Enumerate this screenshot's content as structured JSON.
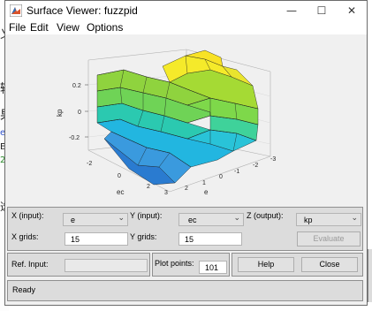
{
  "background": {
    "fragments": [
      "义",
      "输",
      "果",
      "e",
      "E",
      "2",
      "选"
    ]
  },
  "window": {
    "title": "Surface Viewer: fuzzpid",
    "controls": {
      "minimize": "—",
      "maximize": "☐",
      "close": "✕"
    }
  },
  "menu": [
    "File",
    "Edit",
    "View",
    "Options"
  ],
  "plot": {
    "z_label": "kp",
    "x_label": "e",
    "y_label": "ec",
    "z_ticks": [
      "0.2",
      "0",
      "-0.2"
    ],
    "e_ticks": [
      "3",
      "2",
      "1",
      "0",
      "-1",
      "-2",
      "-3"
    ],
    "ec_ticks": [
      "-2",
      "0",
      "2"
    ],
    "ec_corner_tick": "3",
    "colors": {
      "high": "#f5ea2a",
      "mid": "#8fd33e",
      "low": "#22b6e0",
      "base": "#2a7bd0"
    }
  },
  "controls": {
    "x_input_label": "X (input):",
    "x_input_value": "e",
    "y_input_label": "Y (input):",
    "y_input_value": "ec",
    "z_output_label": "Z (output):",
    "z_output_value": "kp",
    "x_grids_label": "X grids:",
    "x_grids_value": "15",
    "y_grids_label": "Y grids:",
    "y_grids_value": "15",
    "evaluate_label": "Evaluate",
    "ref_input_label": "Ref. Input:",
    "ref_input_value": "",
    "plot_points_label": "Plot points:",
    "plot_points_value": "101",
    "help_label": "Help",
    "close_label": "Close",
    "status": "Ready"
  }
}
